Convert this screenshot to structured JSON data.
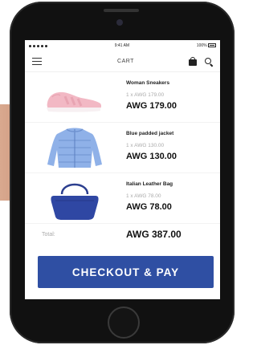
{
  "status_bar": {
    "time": "9:41 AM",
    "battery": "100%"
  },
  "header": {
    "title": "CART",
    "icons": [
      "menu-icon",
      "bag-icon",
      "search-icon"
    ]
  },
  "cart": {
    "items": [
      {
        "name": "Woman Sneakers",
        "quantity_line": "1 x AWG 179.00",
        "price": "AWG 179.00",
        "image": "pink-sneaker"
      },
      {
        "name": "Blue padded jacket",
        "quantity_line": "1 x AWG 130.00",
        "price": "AWG 130.00",
        "image": "blue-jacket"
      },
      {
        "name": "Italian Leather Bag",
        "quantity_line": "1 x AWG 78.00",
        "price": "AWG 78.00",
        "image": "blue-bag"
      }
    ],
    "total_label": "Total:",
    "total_value": "AWG 387.00"
  },
  "checkout": {
    "label": "CHECKOUT & PAY"
  },
  "colors": {
    "accent": "#2f4fa3",
    "muted_text": "#aaaaaa",
    "phone_body": "#111111"
  }
}
